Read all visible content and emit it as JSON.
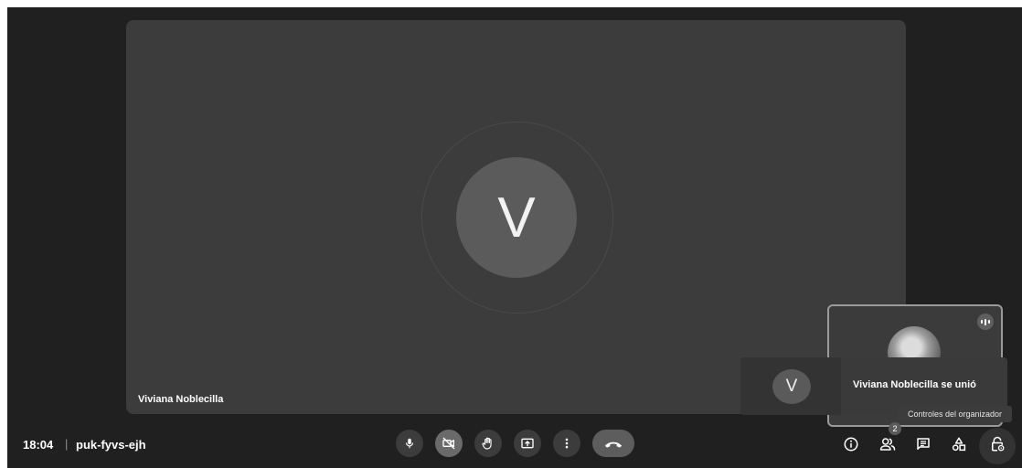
{
  "main_tile": {
    "avatar_letter": "V",
    "participant_name": "Viviana Noblecilla"
  },
  "toast": {
    "avatar_letter": "V",
    "message": "Viviana Noblecilla se unió"
  },
  "tooltip": {
    "text": "Controles del organizador"
  },
  "meeting": {
    "time": "18:04",
    "separator": "|",
    "code": "puk-fyvs-ejh"
  },
  "controls": [
    {
      "name": "microphone",
      "icon": "mic-icon",
      "state": "on"
    },
    {
      "name": "camera",
      "icon": "video-off-icon",
      "state": "off"
    },
    {
      "name": "raise-hand",
      "icon": "hand-icon"
    },
    {
      "name": "present",
      "icon": "present-screen-icon"
    },
    {
      "name": "more-options",
      "icon": "more-vert-icon"
    },
    {
      "name": "leave-call",
      "icon": "call-end-icon"
    }
  ],
  "right_controls": {
    "people_count": "2",
    "icons": [
      "info-icon",
      "people-icon",
      "chat-icon",
      "activities-icon",
      "host-controls-icon"
    ]
  },
  "colors": {
    "background": "#202020",
    "tile": "#3c3c3c",
    "avatar": "#5b5b5b"
  }
}
